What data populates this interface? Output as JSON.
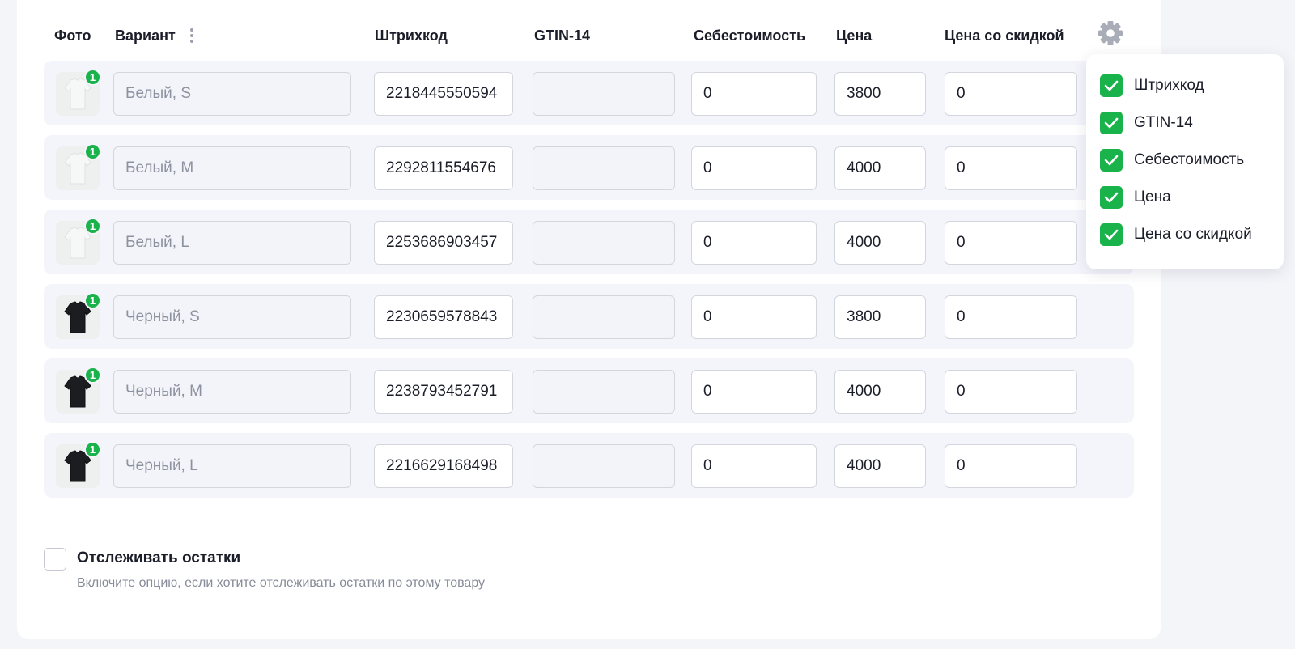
{
  "table": {
    "headers": {
      "photo": "Фото",
      "variant": "Вариант",
      "barcode": "Штрихкод",
      "gtin": "GTIN-14",
      "cost": "Себестоимость",
      "price": "Цена",
      "discount_price": "Цена со скидкой"
    },
    "rows": [
      {
        "color": "white",
        "badge": "1",
        "variant": "Белый, S",
        "barcode": "2218445550594",
        "gtin": "",
        "cost": "0",
        "price": "3800",
        "discount_price": "0"
      },
      {
        "color": "white",
        "badge": "1",
        "variant": "Белый, M",
        "barcode": "2292811554676",
        "gtin": "",
        "cost": "0",
        "price": "4000",
        "discount_price": "0"
      },
      {
        "color": "white",
        "badge": "1",
        "variant": "Белый, L",
        "barcode": "2253686903457",
        "gtin": "",
        "cost": "0",
        "price": "4000",
        "discount_price": "0"
      },
      {
        "color": "black",
        "badge": "1",
        "variant": "Черный, S",
        "barcode": "2230659578843",
        "gtin": "",
        "cost": "0",
        "price": "3800",
        "discount_price": "0"
      },
      {
        "color": "black",
        "badge": "1",
        "variant": "Черный, M",
        "barcode": "2238793452791",
        "gtin": "",
        "cost": "0",
        "price": "4000",
        "discount_price": "0"
      },
      {
        "color": "black",
        "badge": "1",
        "variant": "Черный, L",
        "barcode": "2216629168498",
        "gtin": "",
        "cost": "0",
        "price": "4000",
        "discount_price": "0"
      }
    ]
  },
  "columns_menu": {
    "items": [
      {
        "label": "Штрихкод",
        "checked": true
      },
      {
        "label": "GTIN-14",
        "checked": true
      },
      {
        "label": "Себестоимость",
        "checked": true
      },
      {
        "label": "Цена",
        "checked": true
      },
      {
        "label": "Цена со скидкой",
        "checked": true
      }
    ]
  },
  "track_stock": {
    "label": "Отслеживать остатки",
    "description": "Включите опцию, если хотите отслеживать остатки по этому товару",
    "checked": false
  },
  "icons": {
    "settings": "gear-icon",
    "more": "kebab-icon",
    "check": "check-icon"
  },
  "colors": {
    "accent": "#19b24b",
    "row_bg": "#f4f4fb",
    "page_bg": "#f4f5f9"
  }
}
